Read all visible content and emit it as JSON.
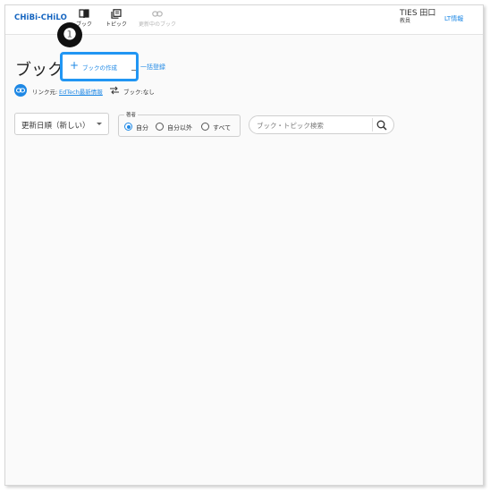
{
  "header": {
    "logo": "CHiBi-CHiLO",
    "nav": [
      {
        "label": "ブック",
        "icon": "book-icon"
      },
      {
        "label": "トピック",
        "icon": "topic-icon"
      },
      {
        "label": "更新中のブック",
        "icon": "link-icon",
        "disabled": true
      }
    ],
    "user": {
      "name": "TIES 田口",
      "role": "教員"
    },
    "lt_link": "LT情報"
  },
  "page": {
    "title": "ブック",
    "create_button": "ブックの作成",
    "create_icon": "plus-icon",
    "bulk_register": "一括登録",
    "callout": "❶"
  },
  "link_row": {
    "icon": "link-circle-icon",
    "prefix": "リンク元:",
    "target": "EdTech最新情報",
    "swap_icon": "swap-arrows-icon",
    "book_status": "ブック:なし"
  },
  "filters": {
    "sort": {
      "value": "更新日順（新しい）"
    },
    "author": {
      "legend": "著者",
      "options": [
        {
          "label": "自分",
          "checked": true
        },
        {
          "label": "自分以外",
          "checked": false
        },
        {
          "label": "すべて",
          "checked": false
        }
      ]
    },
    "search": {
      "placeholder": "ブック・トピック検索",
      "icon": "search-icon"
    }
  },
  "colors": {
    "accent": "#1e88e5",
    "highlight": "#2196f3"
  }
}
